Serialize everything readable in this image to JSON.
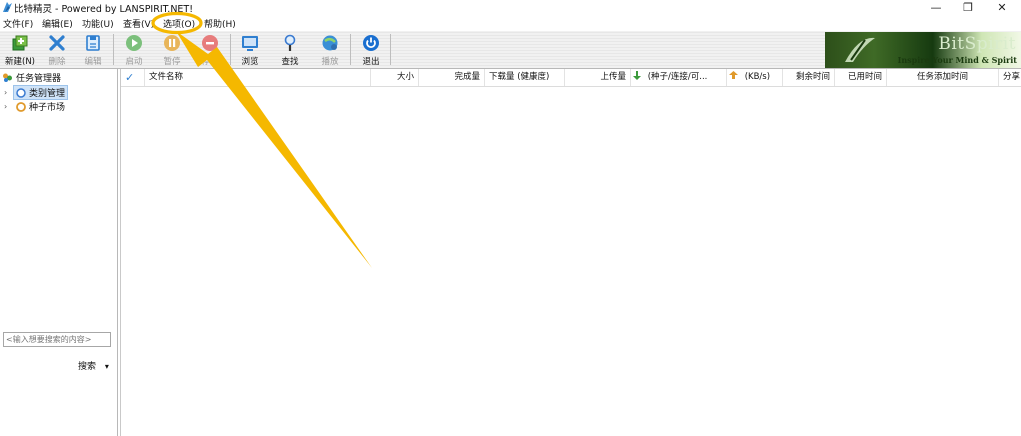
{
  "window": {
    "title": "比特精灵 - Powered by LANSPIRIT.NET!",
    "minimize_glyph": "—",
    "maximize_glyph": "❐",
    "close_glyph": "✕"
  },
  "menu": {
    "items": [
      {
        "label": "文件(F)"
      },
      {
        "label": "编辑(E)"
      },
      {
        "label": "功能(U)"
      },
      {
        "label": "查看(V)"
      },
      {
        "label": "选项(O)"
      },
      {
        "label": "帮助(H)"
      }
    ]
  },
  "toolbar": {
    "buttons": [
      {
        "label": "新建(N)",
        "icon": "new-task-icon",
        "enabled": true
      },
      {
        "label": "删除",
        "icon": "delete-icon",
        "enabled": false
      },
      {
        "label": "编辑",
        "icon": "edit-icon",
        "enabled": false
      },
      {
        "label": "启动",
        "icon": "play-icon",
        "enabled": false
      },
      {
        "label": "暂停",
        "icon": "pause-icon",
        "enabled": false
      },
      {
        "label": "停止",
        "icon": "stop-icon",
        "enabled": false
      },
      {
        "label": "浏览",
        "icon": "browse-icon",
        "enabled": true
      },
      {
        "label": "查找",
        "icon": "find-icon",
        "enabled": true
      },
      {
        "label": "播放",
        "icon": "media-play-icon",
        "enabled": false
      },
      {
        "label": "退出",
        "icon": "power-icon",
        "enabled": true
      }
    ]
  },
  "banner": {
    "title": "BitSpirit",
    "slogan": "Inspire Your Mind & Spirit"
  },
  "sidebar": {
    "root": "任务管理器",
    "items": [
      {
        "label": "类别管理",
        "selected": true
      },
      {
        "label": "种子市场",
        "selected": false
      }
    ],
    "search_placeholder": "<输入想要搜索的内容>",
    "search_button": "搜索",
    "search_dropdown_glyph": "▾"
  },
  "table": {
    "check_glyph": "✓",
    "columns": [
      "文件名称",
      "大小",
      "完成量",
      "下载量 (健康度)",
      "上传量",
      "(种子/连接/可...",
      "(KB/s)",
      "剩余时间",
      "已用时间",
      "任务添加时间",
      "分享"
    ]
  },
  "colors": {
    "annotation": "#f5b800",
    "banner_dark": "#2d4f1a",
    "selection": "#cfe3f8"
  }
}
